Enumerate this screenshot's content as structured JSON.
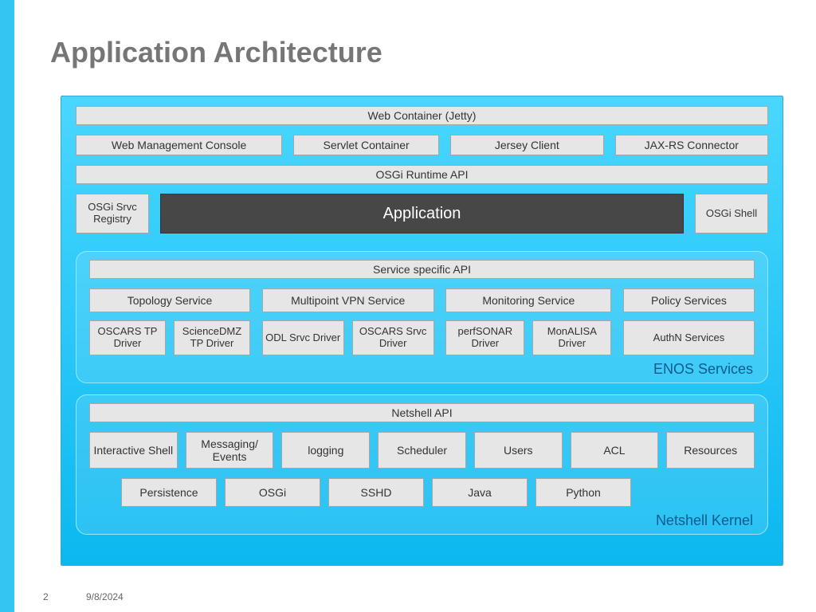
{
  "title": "Application Architecture",
  "top": {
    "web_container": "Web Container (Jetty)",
    "row2": [
      "Web Management Console",
      "Servlet Container",
      "Jersey Client",
      "JAX-RS Connector"
    ],
    "osgi_runtime": "OSGi Runtime API",
    "osgi_registry": "OSGi Srvc Registry",
    "application": "Application",
    "osgi_shell": "OSGi Shell"
  },
  "enos": {
    "label": "ENOS Services",
    "api": "Service specific API",
    "topology": {
      "hdr": "Topology Service",
      "drv1": "OSCARS TP Driver",
      "drv2": "ScienceDMZ TP Driver"
    },
    "vpn": {
      "hdr": "Multipoint VPN Service",
      "drv1": "ODL Srvc Driver",
      "drv2": "OSCARS Srvc Driver"
    },
    "monitor": {
      "hdr": "Monitoring Service",
      "drv1": "perfSONAR Driver",
      "drv2": "MonALISA Driver"
    },
    "policy": {
      "hdr": "Policy Services",
      "drv1": "AuthN Services"
    }
  },
  "kernel": {
    "label": "Netshell Kernel",
    "api": "Netshell API",
    "row1": [
      "Interactive Shell",
      "Messaging/ Events",
      "logging",
      "Scheduler",
      "Users",
      "ACL",
      "Resources"
    ],
    "row2": [
      "Persistence",
      "OSGi",
      "SSHD",
      "Java",
      "Python"
    ]
  },
  "footer": {
    "page": "2",
    "date": "9/8/2024"
  }
}
